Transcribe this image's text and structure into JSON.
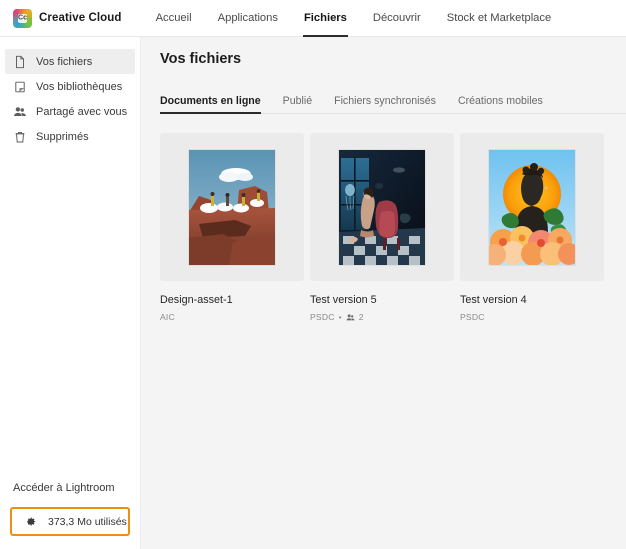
{
  "topbar": {
    "logo_icon": "creative-cloud-logo",
    "brand": "Creative Cloud",
    "nav": [
      {
        "label": "Accueil",
        "active": false
      },
      {
        "label": "Applications",
        "active": false
      },
      {
        "label": "Fichiers",
        "active": true
      },
      {
        "label": "Découvrir",
        "active": false
      },
      {
        "label": "Stock et Marketplace",
        "active": false
      }
    ]
  },
  "sidebar": {
    "items": [
      {
        "label": "Vos fichiers",
        "icon": "file-icon",
        "active": true
      },
      {
        "label": "Vos bibliothèques",
        "icon": "library-icon",
        "active": false
      },
      {
        "label": "Partagé avec vous",
        "icon": "people-icon",
        "active": false
      },
      {
        "label": "Supprimés",
        "icon": "trash-icon",
        "active": false
      }
    ],
    "lightroom_link": "Accéder à Lightroom",
    "storage": {
      "icon": "gear-icon",
      "label": "373,3 Mo utilisés",
      "border_color": "#eb9010"
    }
  },
  "main": {
    "title": "Vos fichiers",
    "tabs": [
      {
        "label": "Documents en ligne",
        "active": true
      },
      {
        "label": "Publié",
        "active": false
      },
      {
        "label": "Fichiers synchronisés",
        "active": false
      },
      {
        "label": "Créations mobiles",
        "active": false
      }
    ],
    "cards": [
      {
        "name": "Design-asset-1",
        "type": "AIC",
        "shared_count": null,
        "thumb": "desert-rocks-clouds-figures"
      },
      {
        "name": "Test version 5",
        "type": "PSDC",
        "shared_count": "2",
        "thumb": "underwater-room-armchair"
      },
      {
        "name": "Test version 4",
        "type": "PSDC",
        "shared_count": null,
        "thumb": "bust-sun-flowers"
      }
    ]
  }
}
